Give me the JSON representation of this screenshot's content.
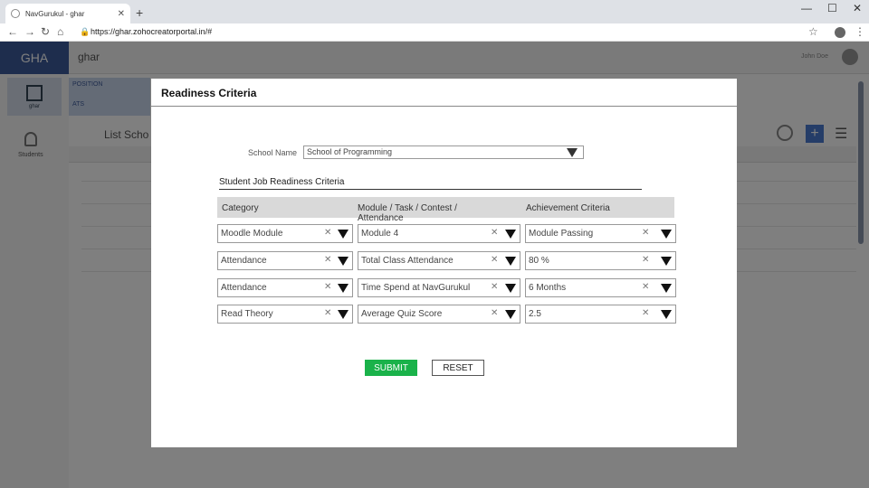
{
  "browser": {
    "tab_title": "NavGurukul - ghar",
    "url": "https://ghar.zohocreatorportal.in/#"
  },
  "app": {
    "logo": "GHA",
    "name": "ghar",
    "banner_line1": "POSITION",
    "banner_line2": "ATS",
    "list_title": "List Scho",
    "sidebar_qr_label": "ghar",
    "sidebar_students_label": "Students",
    "user_name": "John Doe"
  },
  "modal": {
    "title": "Readiness Criteria",
    "school_label": "School Name",
    "school_value": "School of Programming",
    "section_title": "Student Job Readiness Criteria",
    "columns": [
      "Category",
      "Module / Task / Contest / Attendance",
      "Achievement Criteria"
    ],
    "rows": [
      [
        "Moodle Module",
        "Module 4",
        "Module Passing"
      ],
      [
        "Attendance",
        "Total Class Attendance",
        "80 %"
      ],
      [
        "Attendance",
        "Time Spend at NavGurukul",
        "6 Months"
      ],
      [
        "Read Theory",
        "Average Quiz Score",
        "2.5"
      ]
    ],
    "submit_label": "SUBMIT",
    "reset_label": "RESET"
  },
  "colors": {
    "submit_bg": "#1ab24a",
    "header_bg": "#d9d9d9",
    "logo_bg": "#3c5a9a"
  }
}
